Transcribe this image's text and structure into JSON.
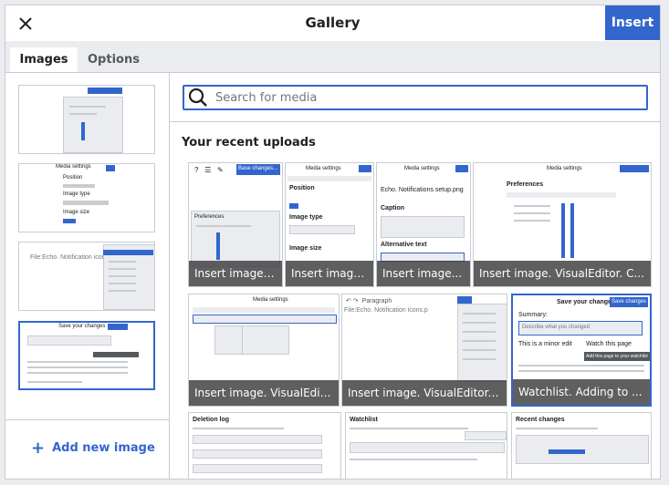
{
  "dialog": {
    "title": "Gallery",
    "insert_label": "Insert",
    "close_icon": "close-icon"
  },
  "tabs": [
    {
      "label": "Images",
      "active": true
    },
    {
      "label": "Options",
      "active": false
    }
  ],
  "sidebar": {
    "add_label": "Add new image",
    "add_icon": "plus-icon"
  },
  "search": {
    "placeholder": "Search for media",
    "value": ""
  },
  "uploads": {
    "heading": "Your recent uploads",
    "items": [
      {
        "caption": "Insert image. ..."
      },
      {
        "caption": "Insert image..."
      },
      {
        "caption": "Insert image..."
      },
      {
        "caption": "Insert image. VisualEditor. C..."
      },
      {
        "caption": "Insert image. VisualEdit..."
      },
      {
        "caption": "Insert image. VisualEditor. ..."
      },
      {
        "caption": "Watchlist. Adding to ..."
      }
    ]
  },
  "thumb_texts": {
    "media_settings": "Media settings",
    "file_name": "Echo. Notifications setup.png",
    "file_icons": "File:Echo. Notification icons.p",
    "save_changes": "Save your changes",
    "save_button": "Save changes",
    "summary": "Summary:",
    "summary_placeholder": "Describe what you changed",
    "minor_edit": "This is a minor edit",
    "watch_page": "Watch this page",
    "tooltip": "Add this page to your watchlist",
    "position": "Position",
    "image_type": "Image type",
    "image_size": "Image size",
    "caption": "Caption",
    "alt_text": "Alternative text",
    "preferences": "Preferences",
    "deletion_log": "Deletion log",
    "watchlist": "Watchlist",
    "recent_changes": "Recent changes",
    "base_changes": "Base changes...",
    "insert": "Insert"
  }
}
